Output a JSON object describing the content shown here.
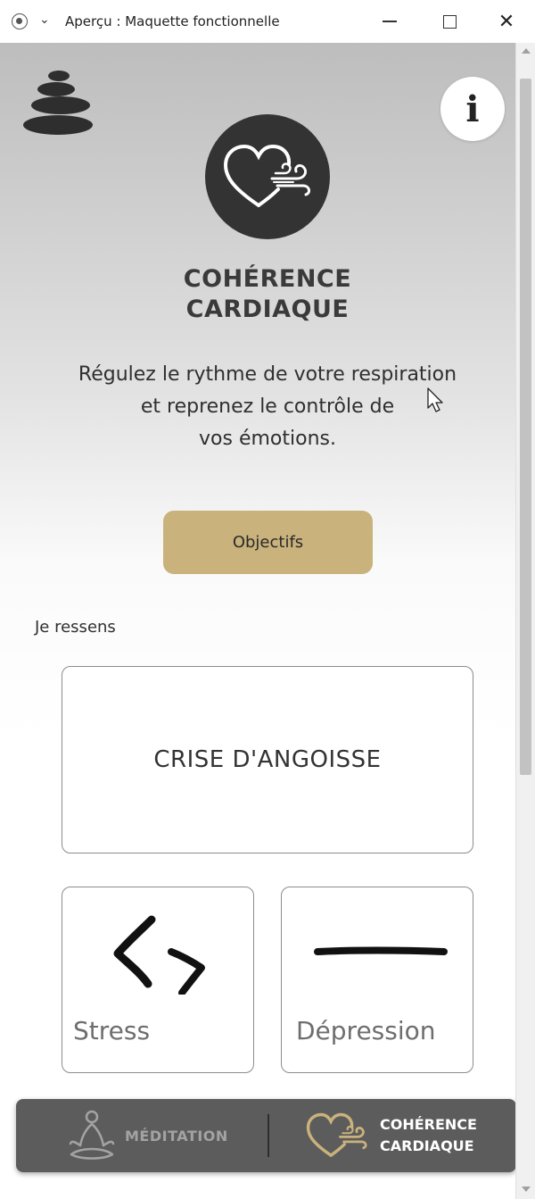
{
  "window": {
    "title": "Aperçu : Maquette fonctionnelle",
    "minimize_icon": "minimize-icon",
    "maximize_icon": "maximize-icon",
    "close_icon": "close-icon"
  },
  "header": {
    "logo_icon": "stacked-stones-icon",
    "info_label": "i"
  },
  "hero": {
    "icon": "heart-wind-icon",
    "title_line1": "COHÉRENCE",
    "title_line2": "CARDIAQUE",
    "text_line1": "Régulez le rythme de votre respiration",
    "text_line2": "et reprenez le contrôle de",
    "text_line3": "vos émotions."
  },
  "objectifs_label": "Objectifs",
  "feelings": {
    "heading": "Je ressens",
    "main": "CRISE D'ANGOISSE",
    "cards": [
      {
        "label": "Stress",
        "icon": "zigzag-brush-icon"
      },
      {
        "label": "Dépression",
        "icon": "flat-line-brush-icon"
      }
    ]
  },
  "nav": {
    "meditation": {
      "label": "MÉDITATION",
      "icon": "meditation-icon"
    },
    "coherence": {
      "label_line1": "COHÉRENCE",
      "label_line2": "CARDIAQUE",
      "icon": "heart-wind-icon"
    }
  },
  "colors": {
    "accent_gold": "#c9b27c",
    "dark_circle": "#333333",
    "nav_bg": "#5c5c5c"
  }
}
